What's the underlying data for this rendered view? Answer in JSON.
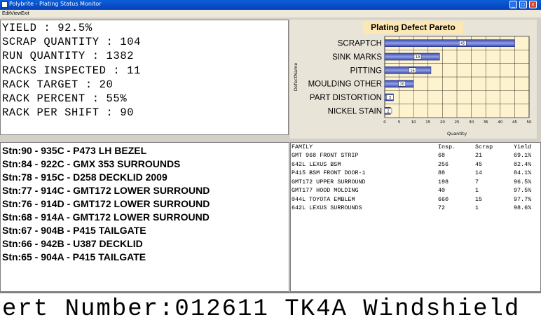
{
  "window": {
    "title": "Polybrite - Plating Status Monitor",
    "buttons": [
      "_",
      "□",
      "×"
    ]
  },
  "menu": {
    "items": [
      "Edit",
      "View",
      "Exit"
    ]
  },
  "stats": [
    "YIELD : 92.5%",
    "SCRAP QUANTITY : 104",
    "RUN QUANTITY : 1382",
    "RACKS INSPECTED : 11",
    "RACK TARGET : 20",
    "RACK PERCENT : 55%",
    "RACK PER SHIFT : 90"
  ],
  "chart_data": {
    "type": "bar",
    "orientation": "horizontal",
    "title": "Plating Defect Pareto",
    "xlabel": "Quantity",
    "ylabel": "DefectName",
    "categories": [
      "SCRAPTCH",
      "SINK MARKS",
      "PITTING",
      "MOULDING OTHER",
      "PART DISTORTION",
      "NICKEL STAIN"
    ],
    "values": [
      45,
      19,
      16,
      10,
      3,
      2
    ],
    "data_labels": [
      "45",
      "19",
      "16",
      "10",
      "3",
      "2"
    ],
    "xlim": [
      0,
      50
    ],
    "xticks": [
      "0",
      "5",
      "10",
      "15",
      "20",
      "25",
      "30",
      "35",
      "40",
      "45",
      "50"
    ],
    "grid": true,
    "colors": {
      "bar": "#3c4aa8",
      "bar_highlight": "#8fa0ea",
      "plot_bg": "#fdf3cf",
      "title_bg": "#fde8b4"
    }
  },
  "stations": [
    "Stn:90 - 935C - P473 LH BEZEL",
    "Stn:84 - 922C - GMX 353 SURROUNDS",
    "Stn:78 - 915C - D258 DECKLID 2009",
    "Stn:77 - 914C - GMT172 LOWER SURROUND",
    "Stn:76 - 914D - GMT172 LOWER SURROUND",
    "Stn:68 - 914A - GMT172 LOWER SURROUND",
    "Stn:67 - 904B - P415 TAILGATE",
    "Stn:66 - 942B - U387 DECKLID",
    "Stn:65 - 904A - P415 TAILGATE"
  ],
  "family_table": {
    "columns": [
      "FAMILY",
      "Insp.",
      "Scrap",
      "Yield"
    ],
    "rows": [
      [
        "GMT 968 FRONT STRIP",
        "68",
        "21",
        "69.1%"
      ],
      [
        "642L LEXUS BSM",
        "256",
        "45",
        "82.4%"
      ],
      [
        "P415 BSM FRONT DOOR-1",
        "88",
        "14",
        "84.1%"
      ],
      [
        "GMT172 UPPER SURROUND",
        "198",
        "7",
        "96.5%"
      ],
      [
        "GMT177 HOOD MOLDING",
        "40",
        "1",
        "97.5%"
      ],
      [
        "044L TOYOTA EMBLEM",
        "660",
        "15",
        "97.7%"
      ],
      [
        "642L LEXUS SURROUNDS",
        "72",
        "1",
        "98.6%"
      ]
    ]
  },
  "ticker": {
    "text": "ert Number:012611 TK4A Windshield"
  }
}
